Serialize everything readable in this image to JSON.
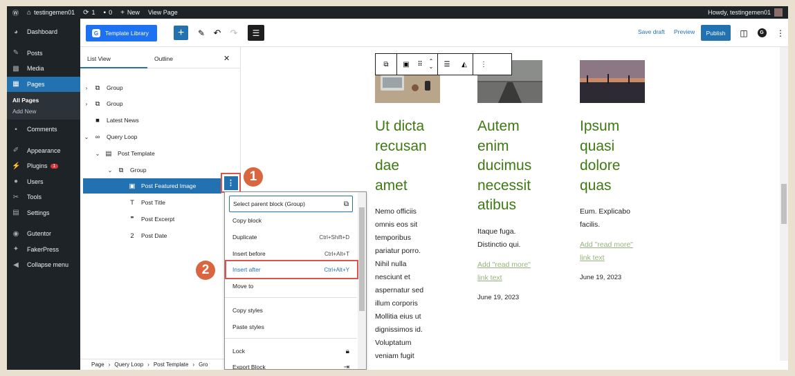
{
  "adminbar": {
    "site_name": "testingemen01",
    "updates_count": "1",
    "comments_count": "0",
    "new_label": "New",
    "view_page": "View Page",
    "howdy": "Howdy, testingemen01"
  },
  "sidebar": {
    "items": [
      {
        "label": "Dashboard",
        "icon": "dashboard-icon"
      },
      {
        "label": "Posts",
        "icon": "pin-icon"
      },
      {
        "label": "Media",
        "icon": "media-icon"
      },
      {
        "label": "Pages",
        "icon": "pages-icon"
      },
      {
        "label": "Comments",
        "icon": "comment-icon"
      },
      {
        "label": "Appearance",
        "icon": "brush-icon"
      },
      {
        "label": "Plugins",
        "icon": "plug-icon",
        "badge": "1"
      },
      {
        "label": "Users",
        "icon": "user-icon"
      },
      {
        "label": "Tools",
        "icon": "wrench-icon"
      },
      {
        "label": "Settings",
        "icon": "settings-icon"
      },
      {
        "label": "Gutentor",
        "icon": "gutentor-icon"
      },
      {
        "label": "FakerPress",
        "icon": "fakerpress-icon"
      },
      {
        "label": "Collapse menu",
        "icon": "collapse-icon"
      }
    ],
    "submenu": [
      "All Pages",
      "Add New"
    ]
  },
  "toolbar": {
    "template_library": "Template Library",
    "save_draft": "Save draft",
    "preview": "Preview",
    "publish": "Publish"
  },
  "listview": {
    "tab_list": "List View",
    "tab_outline": "Outline",
    "close": "✕",
    "rows": [
      {
        "label": "Group",
        "chev": "›",
        "icon": "⧉"
      },
      {
        "label": "Group",
        "chev": "›",
        "icon": "⧉"
      },
      {
        "label": "Latest News",
        "chev": "",
        "icon": "■"
      },
      {
        "label": "Query Loop",
        "chev": "⌄",
        "icon": "∞"
      },
      {
        "label": "Post Template",
        "chev": "⌄",
        "icon": "▤"
      },
      {
        "label": "Group",
        "chev": "⌄",
        "icon": "⧉"
      },
      {
        "label": "Post Featured Image",
        "chev": "",
        "icon": "▣"
      },
      {
        "label": "Post Title",
        "chev": "",
        "icon": "T"
      },
      {
        "label": "Post Excerpt",
        "chev": "",
        "icon": "❞"
      },
      {
        "label": "Post Date",
        "chev": "",
        "icon": "2"
      }
    ]
  },
  "breadcrumb": [
    "Page",
    "Query Loop",
    "Post Template",
    "Gro"
  ],
  "context_menu": {
    "select_parent": "Select parent block (Group)",
    "copy_block": "Copy block",
    "duplicate": "Duplicate",
    "duplicate_sc": "Ctrl+Shift+D",
    "insert_before": "Insert before",
    "insert_before_sc": "Ctrl+Alt+T",
    "insert_after": "Insert after",
    "insert_after_sc": "Ctrl+Alt+Y",
    "move_to": "Move to",
    "copy_styles": "Copy styles",
    "paste_styles": "Paste styles",
    "lock": "Lock",
    "export_block": "Export Block"
  },
  "callouts": [
    "1",
    "2"
  ],
  "posts": [
    {
      "title": "Ut dicta recusan dae amet",
      "title_lines": [
        "Ut dicta",
        "recusan",
        "dae",
        "amet"
      ],
      "excerpt_lines": [
        "Nemo officiis",
        "omnis eos sit",
        "temporibus",
        "pariatur porro.",
        "Nihil nulla",
        "nesciunt et",
        "aspernatur sed",
        "illum corporis",
        "Mollitia eius ut",
        "dignissimos id.",
        "Voluptatum",
        "veniam fugit"
      ],
      "link_lines": [],
      "date": "",
      "image": "laptop-desk-photo"
    },
    {
      "title": "Autem enim ducimus necessit atibus",
      "title_lines": [
        "Autem",
        "enim",
        "ducimus",
        "necessit",
        "atibus"
      ],
      "excerpt_lines": [
        "Itaque fuga.",
        "Distinctio qui."
      ],
      "link_lines": [
        "Add \"read more\"",
        "link text"
      ],
      "date": "June 19, 2023",
      "image": "pier-dusk-photo"
    },
    {
      "title": "Ipsum quasi dolore quas",
      "title_lines": [
        "Ipsum",
        "quasi",
        "dolore",
        "quas"
      ],
      "excerpt_lines": [
        "Eum. Explicabo",
        "facilis."
      ],
      "link_lines": [
        "Add \"read more\"",
        "link text"
      ],
      "date": "June 19, 2023",
      "image": "bridge-sunset-photo"
    }
  ],
  "colors": {
    "admin_dark": "#1d2327",
    "accent": "#2271b1",
    "title_green": "#3d7a12",
    "callout": "#d9663f",
    "highlight": "#d9534f"
  }
}
